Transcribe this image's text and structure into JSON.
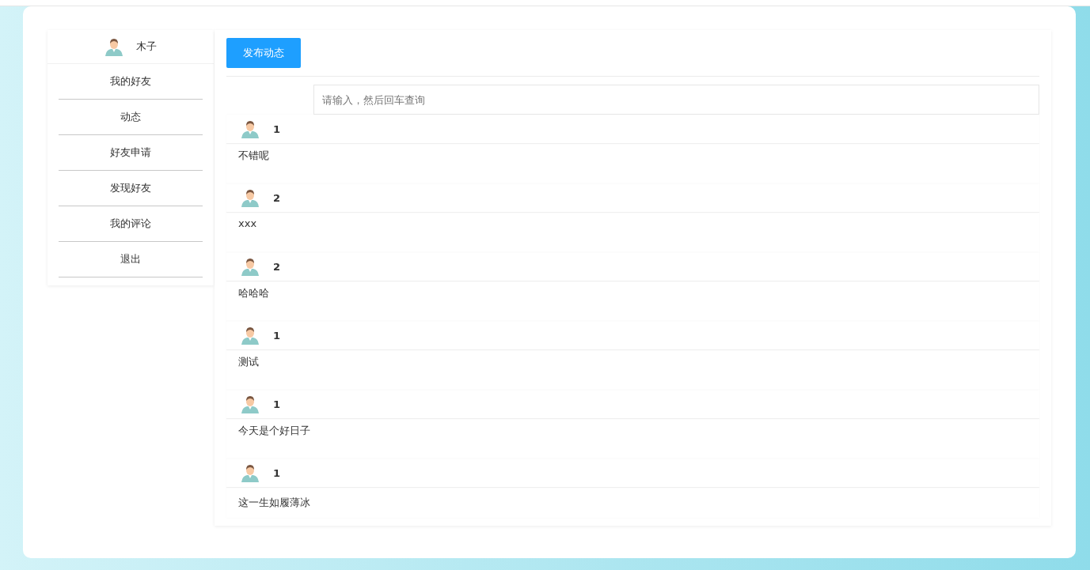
{
  "user": {
    "name": "木子"
  },
  "menu": [
    {
      "label": "我的好友"
    },
    {
      "label": "动态"
    },
    {
      "label": "好友申请"
    },
    {
      "label": "发现好友"
    },
    {
      "label": "我的评论"
    },
    {
      "label": "退出"
    }
  ],
  "publish_button": {
    "label": "发布动态"
  },
  "search": {
    "placeholder": "请输入，然后回车查询"
  },
  "posts": [
    {
      "author": "1",
      "content": "不错呢"
    },
    {
      "author": "2",
      "content": "xxx"
    },
    {
      "author": "2",
      "content": "哈哈哈"
    },
    {
      "author": "1",
      "content": "测试"
    },
    {
      "author": "1",
      "content": "今天是个好日子"
    },
    {
      "author": "1",
      "content": "这一生如履薄冰"
    }
  ]
}
